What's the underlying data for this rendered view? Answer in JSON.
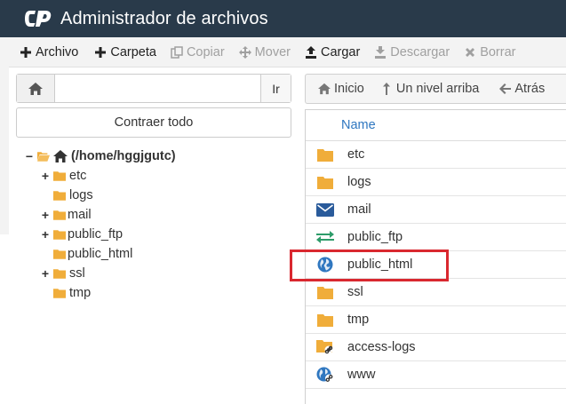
{
  "header": {
    "title": "Administrador de archivos",
    "logo_icon": "cpanel-logo-icon"
  },
  "toolbar": {
    "items": [
      {
        "label": "Archivo",
        "icon": "plus-icon",
        "enabled": true
      },
      {
        "label": "Carpeta",
        "icon": "plus-icon",
        "enabled": true
      },
      {
        "label": "Copiar",
        "icon": "copy-icon",
        "enabled": false
      },
      {
        "label": "Mover",
        "icon": "move-icon",
        "enabled": false
      },
      {
        "label": "Cargar",
        "icon": "upload-icon",
        "enabled": true
      },
      {
        "label": "Descargar",
        "icon": "download-icon",
        "enabled": false
      },
      {
        "label": "Borrar",
        "icon": "delete-icon",
        "enabled": false
      }
    ]
  },
  "left": {
    "search_value": "",
    "go_label": "Ir",
    "collapse_label": "Contraer todo",
    "tree_root": "(/home/hggjgutc)",
    "tree": [
      {
        "label": "etc",
        "expandable": true
      },
      {
        "label": "logs",
        "expandable": false
      },
      {
        "label": "mail",
        "expandable": true
      },
      {
        "label": "public_ftp",
        "expandable": true
      },
      {
        "label": "public_html",
        "expandable": false
      },
      {
        "label": "ssl",
        "expandable": true
      },
      {
        "label": "tmp",
        "expandable": false
      }
    ]
  },
  "right": {
    "nav": {
      "home": "Inicio",
      "up": "Un nivel arriba",
      "back": "Atrás"
    },
    "column_name": "Name",
    "files": [
      {
        "name": "etc",
        "icon": "folder-icon"
      },
      {
        "name": "logs",
        "icon": "folder-icon"
      },
      {
        "name": "mail",
        "icon": "mail-icon"
      },
      {
        "name": "public_ftp",
        "icon": "transfer-icon"
      },
      {
        "name": "public_html",
        "icon": "globe-icon"
      },
      {
        "name": "ssl",
        "icon": "folder-icon"
      },
      {
        "name": "tmp",
        "icon": "folder-icon"
      },
      {
        "name": "access-logs",
        "icon": "folder-link-icon"
      },
      {
        "name": "www",
        "icon": "globe-link-icon"
      }
    ],
    "highlighted": "public_html"
  },
  "colors": {
    "header_bg": "#293a4a",
    "folder": "#f0ad3a",
    "link": "#2f77c0",
    "highlight": "#d9282f",
    "mail": "#2a5b9b",
    "transfer": "#2e9c6a"
  }
}
